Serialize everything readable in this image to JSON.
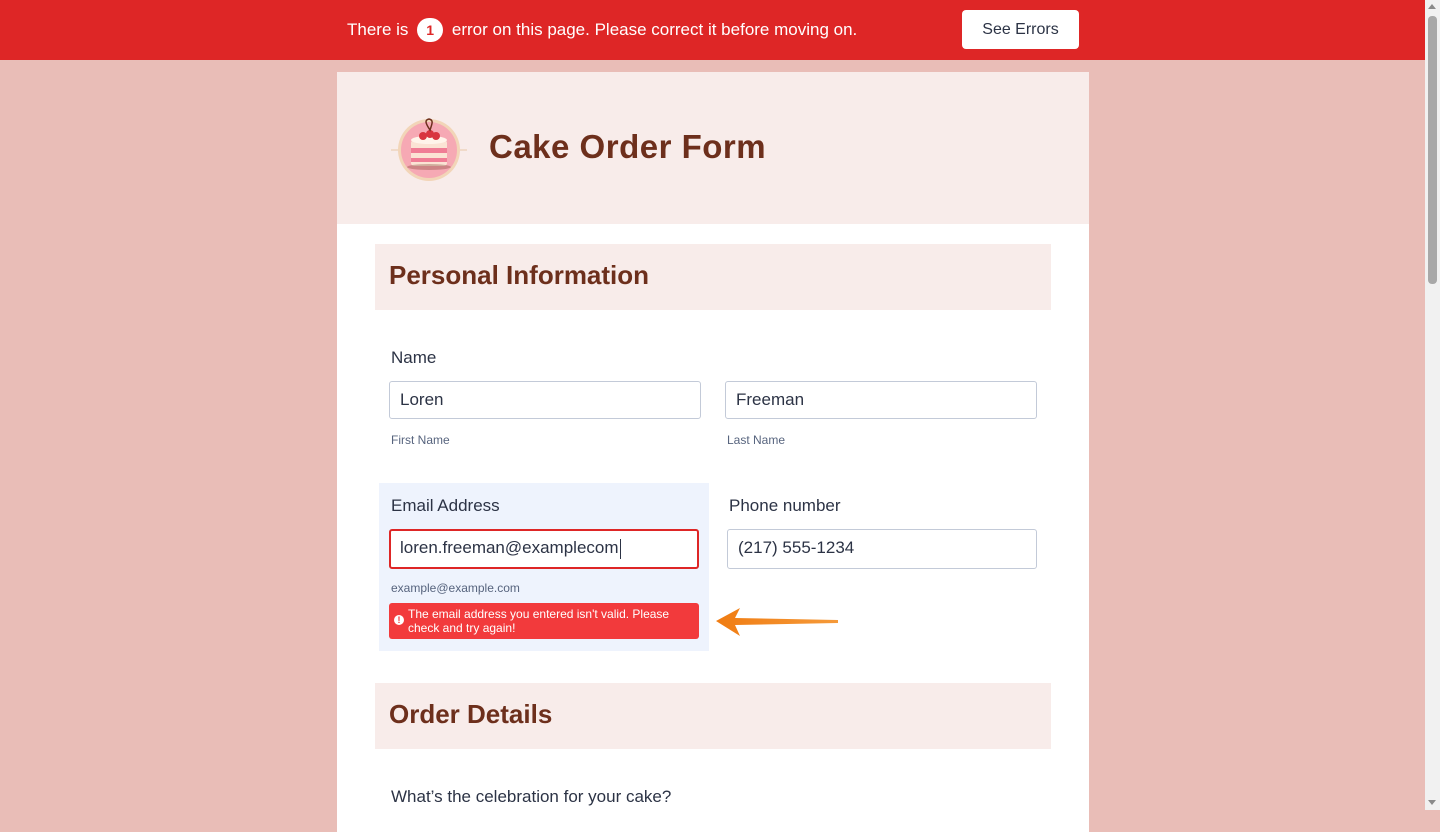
{
  "banner": {
    "prefix": "There is",
    "error_count": "1",
    "suffix": "error on this page. Please correct it before moving on.",
    "button_label": "See Errors"
  },
  "form": {
    "title": "Cake Order Form",
    "sections": {
      "personal": "Personal Information",
      "order": "Order Details"
    },
    "name": {
      "label": "Name",
      "first_value": "Loren",
      "first_sublabel": "First Name",
      "last_value": "Freeman",
      "last_sublabel": "Last Name"
    },
    "email": {
      "label": "Email Address",
      "value": "loren.freeman@examplecom",
      "sublabel": "example@example.com",
      "error": "The email address you entered isn't valid. Please check and try again!"
    },
    "phone": {
      "label": "Phone number",
      "value": "(217) 555-1234"
    },
    "celebration_question": "What’s the celebration for your cake?"
  },
  "colors": {
    "banner": "#de2626",
    "page_background": "#e9bdb7",
    "header_background": "#f8ecea",
    "title_color": "#6d2f1c",
    "error_message": "#f23a3c",
    "arrow": "#f07c12"
  },
  "icons": {
    "logo": "cake-logo-icon",
    "error": "alert-circle-icon",
    "annotation": "arrow-left-icon"
  }
}
